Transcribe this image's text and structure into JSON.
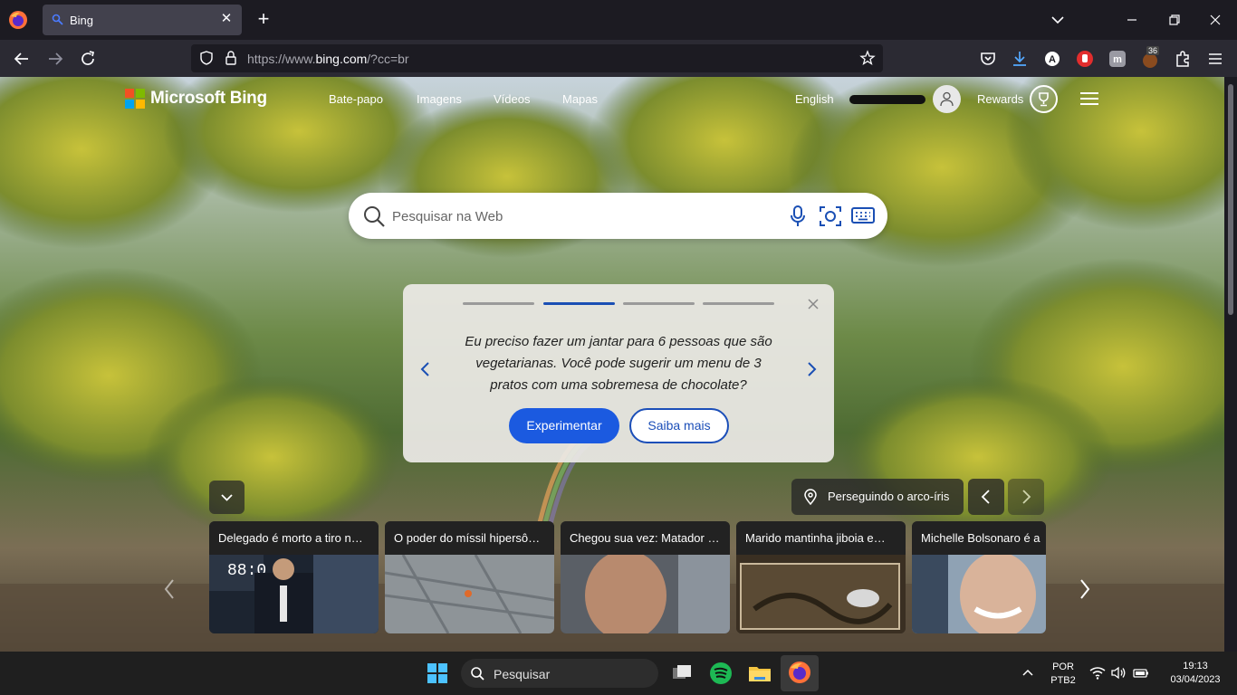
{
  "browser": {
    "tab_title": "Bing",
    "url_prefix": "https://www.",
    "url_domain": "bing.com",
    "url_suffix": "/?cc=br",
    "badge_count": "36"
  },
  "bing": {
    "logo_text": "Microsoft Bing",
    "nav": [
      "Bate-papo",
      "Imagens",
      "Vídeos",
      "Mapas"
    ],
    "language": "English",
    "rewards": "Rewards",
    "search_placeholder": "Pesquisar na Web",
    "card": {
      "text": "Eu preciso fazer um jantar para 6 pessoas que são vegetarianas. Você pode sugerir um menu de 3 pratos com uma sobremesa de chocolate?",
      "primary": "Experimentar",
      "secondary": "Saiba mais",
      "progress_active_index": 1
    },
    "location": "Perseguindo o arco-íris",
    "news": [
      {
        "title": "Delegado é morto a tiro n…"
      },
      {
        "title": "O poder do míssil hipersô…"
      },
      {
        "title": "Chegou sua vez: Matador …"
      },
      {
        "title": "Marido mantinha jiboia e…"
      },
      {
        "title": "Michelle Bolsonaro é a"
      }
    ]
  },
  "taskbar": {
    "search": "Pesquisar",
    "lang1": "POR",
    "lang2": "PTB2",
    "time": "19:13",
    "date": "03/04/2023"
  },
  "colors": {
    "accent": "#1b5ae0",
    "browser_bg": "#1c1b22",
    "toolbar_bg": "#2b2a33"
  }
}
